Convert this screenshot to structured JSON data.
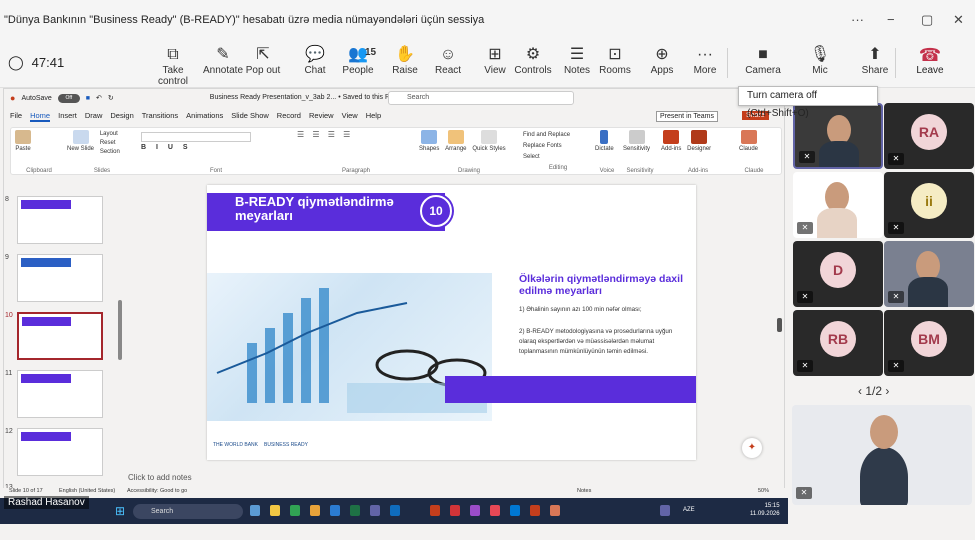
{
  "window": {
    "title": "\"Dünya Bankının \"Business Ready\" (B-READY)\" hesabatı üzrə media nümayəndələri üçün sessiya",
    "controls": [
      "···",
      "−",
      "▢",
      "✕"
    ]
  },
  "meeting": {
    "timer": "47:41",
    "toolbar": [
      {
        "id": "take-control",
        "label": "Take control",
        "icon": "⧉"
      },
      {
        "id": "annotate",
        "label": "Annotate",
        "icon": "✎"
      },
      {
        "id": "popout",
        "label": "Pop out",
        "icon": "⇱"
      },
      {
        "id": "chat",
        "label": "Chat",
        "icon": "💬"
      },
      {
        "id": "people",
        "label": "People",
        "icon": "👥",
        "badge": "15"
      },
      {
        "id": "raise",
        "label": "Raise",
        "icon": "✋"
      },
      {
        "id": "react",
        "label": "React",
        "icon": "☺"
      },
      {
        "id": "view",
        "label": "View",
        "icon": "⊞"
      },
      {
        "id": "controls",
        "label": "Controls",
        "icon": "⚙"
      },
      {
        "id": "notes",
        "label": "Notes",
        "icon": "☰"
      },
      {
        "id": "rooms",
        "label": "Rooms",
        "icon": "⊡"
      },
      {
        "id": "apps",
        "label": "Apps",
        "icon": "⊕"
      },
      {
        "id": "more",
        "label": "More",
        "icon": "···"
      },
      {
        "id": "camera",
        "label": "Camera",
        "icon": "■"
      },
      {
        "id": "mic",
        "label": "Mic",
        "icon": "🎙"
      },
      {
        "id": "share",
        "label": "Share",
        "icon": "⬆"
      }
    ],
    "leave_label": "Leave",
    "tooltip": "Turn camera off (Ctrl+Shift+O)"
  },
  "ppt": {
    "autosave": "AutoSave",
    "autosave_state": "Off",
    "filename": "Business Ready Presentation_v_3ab 2... • Saved to this PC ⌵",
    "search_placeholder": "Search",
    "menu": [
      "File",
      "Home",
      "Insert",
      "Draw",
      "Design",
      "Transitions",
      "Animations",
      "Slide Show",
      "Record",
      "Review",
      "View",
      "Help"
    ],
    "present_teams": "Present in Teams",
    "share": "Share",
    "ribbon_groups": [
      "Clipboard",
      "Slides",
      "Font",
      "Paragraph",
      "Drawing",
      "Editing",
      "Voice",
      "Sensitivity",
      "Add-ins",
      "Claude"
    ],
    "ribbon_items": {
      "paste": "Paste",
      "new_slide": "New Slide",
      "layout": "Layout",
      "reset": "Reset",
      "section": "Section",
      "shapes": "Shapes",
      "arrange": "Arrange",
      "quick_styles": "Quick Styles",
      "find": "Find and Replace",
      "replace_fonts": "Replace Fonts",
      "select": "Select",
      "dictate": "Dictate",
      "sensitivity": "Sensitivity",
      "addins": "Add-ins",
      "designer": "Designer",
      "claude": "Claude"
    },
    "thumb_numbers": [
      "8",
      "9",
      "10",
      "11",
      "12",
      "13"
    ],
    "slide": {
      "title": "B-READY qiymətləndirmə meyarları",
      "number": "10",
      "right_title": "Ölkələrin qiymətləndirməyə daxil edilmə meyarları",
      "point1": "1) Əhalinin sayının azı 100 min nəfər olması;",
      "point2": "2) B-READY metodologiyasına və prosedurlarına uyğun olaraq ekspertlərdən və müəssisələrdən məlumat toplanmasının mümkünlüyünün təmin edilməsi.",
      "logo1": "THE WORLD BANK",
      "logo2": "BUSINESS READY"
    },
    "notes_placeholder": "Click to add notes",
    "status": {
      "slide": "Slide 10 of 17",
      "lang": "English (United States)",
      "access": "Accessibility: Good to go",
      "notes": "Notes",
      "zoom": "50%"
    }
  },
  "taskbar": {
    "presenter": "Rashad Hasanov",
    "search": "Search",
    "lang": "AZE",
    "time": "15:15",
    "date": "11.09.2026"
  },
  "participants": {
    "tiles": [
      {
        "initials": "",
        "bg": "#3a3a3a",
        "video": true
      },
      {
        "initials": "RA",
        "bg": "#f1d5d8",
        "fg": "#a33a4c"
      },
      {
        "initials": "",
        "bg": "#ffffff",
        "video": true
      },
      {
        "initials": "ii",
        "bg": "#f5ecc4",
        "fg": "#9a7a10"
      },
      {
        "initials": "D",
        "bg": "#f1d5d8",
        "fg": "#a33a4c"
      },
      {
        "initials": "",
        "bg": "#7a8090",
        "video": true
      },
      {
        "initials": "RB",
        "bg": "#f1d5d8",
        "fg": "#a33a4c"
      },
      {
        "initials": "BM",
        "bg": "#f1d5d8",
        "fg": "#a33a4c"
      }
    ],
    "pager": "1/2"
  },
  "colors": {
    "brand_purple": "#5a2ddb",
    "teams_accent": "#6264a7",
    "leave_red": "#c4314b"
  }
}
